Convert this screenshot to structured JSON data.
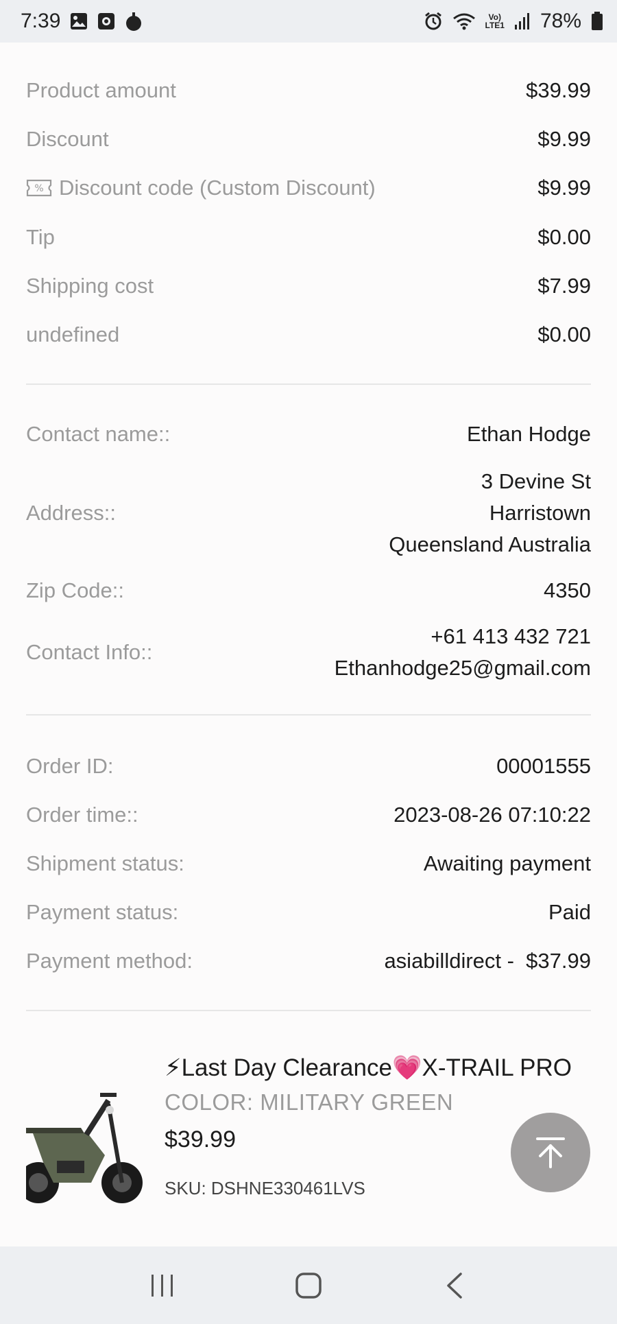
{
  "status_bar": {
    "time": "7:39",
    "battery": "78%",
    "volte_line1": "Vo)",
    "volte_line2": "LTE1"
  },
  "summary": {
    "rows": [
      {
        "label": "Product amount",
        "value": "$39.99"
      },
      {
        "label": "Discount",
        "value": "$9.99"
      },
      {
        "label": "Discount code (Custom Discount)",
        "value": "$9.99",
        "icon": "coupon-icon"
      },
      {
        "label": "Tip",
        "value": "$0.00"
      },
      {
        "label": "Shipping cost",
        "value": "$7.99"
      },
      {
        "label": "undefined",
        "value": "$0.00"
      }
    ]
  },
  "contact": {
    "name_label": "Contact name::",
    "name": "Ethan Hodge",
    "address_label": "Address::",
    "address_lines": [
      "3 Devine St",
      "Harristown",
      "Queensland Australia"
    ],
    "zip_label": "Zip Code::",
    "zip": "4350",
    "info_label": "Contact Info::",
    "phone": "+61 413 432 721",
    "email": "Ethanhodge25@gmail.com"
  },
  "order": {
    "rows": [
      {
        "label": "Order ID:",
        "value": "00001555"
      },
      {
        "label": "Order time::",
        "value": "2023-08-26 07:10:22"
      },
      {
        "label": "Shipment status:",
        "value": "Awaiting payment"
      },
      {
        "label": "Payment status:",
        "value": "Paid"
      },
      {
        "label": "Payment method:",
        "value": "asiabilldirect -  $37.99"
      }
    ]
  },
  "product": {
    "title": "⚡Last Day Clearance💗X-TRAIL PRO",
    "variant": "COLOR: MILITARY GREEN",
    "price": "$39.99",
    "sku": "SKU: DSHNE330461LVS"
  },
  "colors": {
    "label_gray": "#9b9b9b",
    "text": "#1c1c1c",
    "back_top": "#a09e9e",
    "bars": "#edeff2"
  }
}
